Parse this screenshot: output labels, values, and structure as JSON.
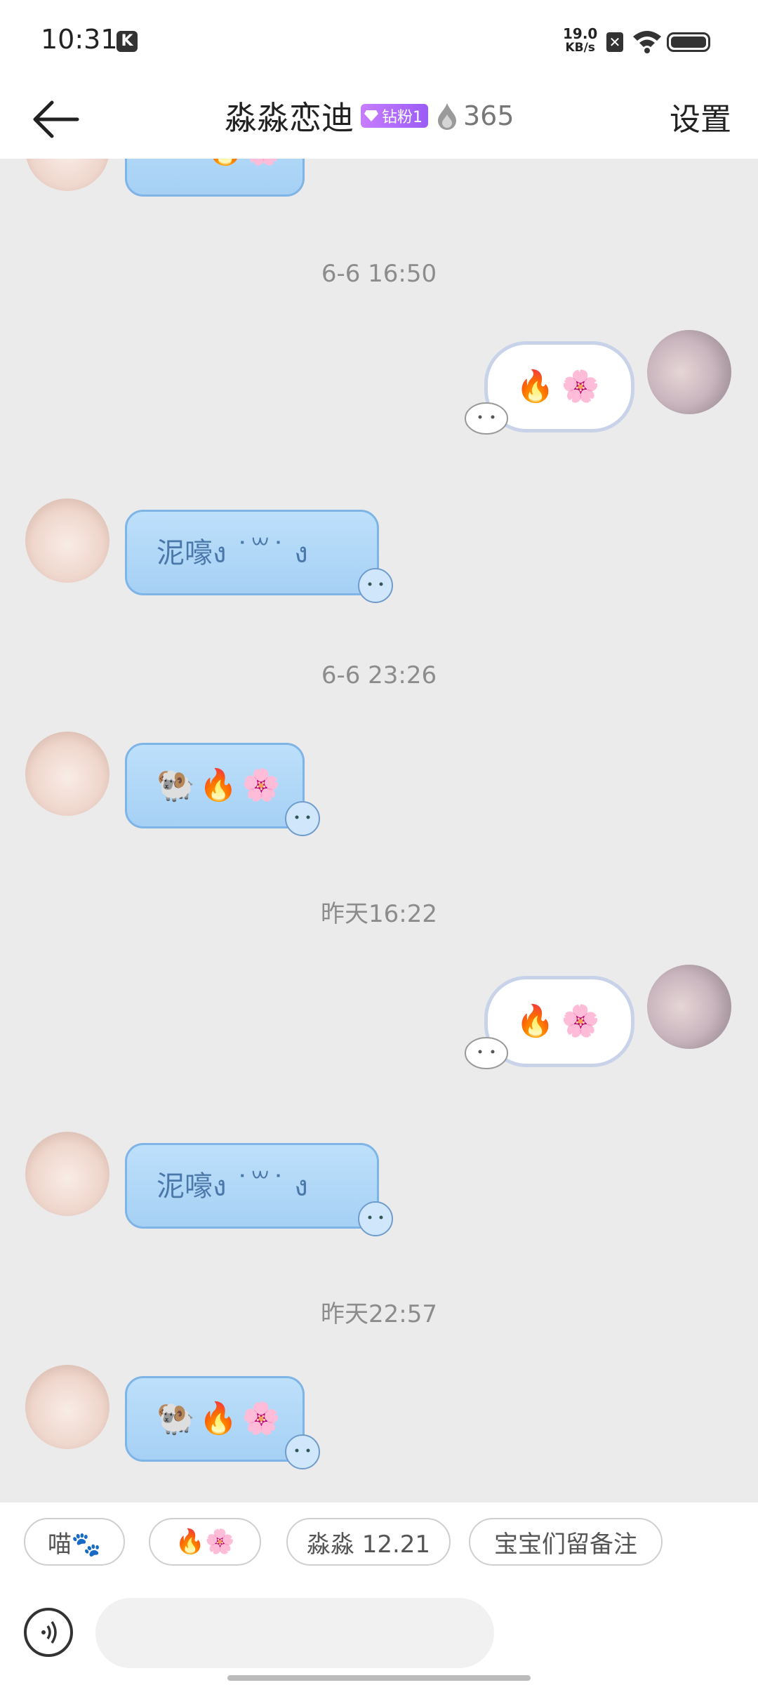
{
  "status": {
    "time": "10:31",
    "net_speed_value": "19.0",
    "net_speed_unit": "KB/s"
  },
  "header": {
    "title": "淼淼恋迪",
    "badge": "钻粉1",
    "heat": "365",
    "settings": "设置"
  },
  "messages": [
    {
      "kind": "time",
      "text": "6-6 16:50"
    },
    {
      "kind": "out",
      "emojis": [
        "🔥",
        "🌸"
      ]
    },
    {
      "kind": "in",
      "text": "泥嚎ง ˙꒳˙ ง"
    },
    {
      "kind": "time",
      "text": "6-6 23:26"
    },
    {
      "kind": "in",
      "emojis": [
        "🐏",
        "🔥",
        "🌸"
      ]
    },
    {
      "kind": "time",
      "text": "昨天16:22"
    },
    {
      "kind": "out",
      "emojis": [
        "🔥",
        "🌸"
      ]
    },
    {
      "kind": "in",
      "text": "泥嚎ง ˙꒳˙ ง"
    },
    {
      "kind": "time",
      "text": "昨天22:57"
    },
    {
      "kind": "in",
      "emojis": [
        "🐏",
        "🔥",
        "🌸"
      ]
    }
  ],
  "quick_replies": [
    "喵🐾",
    "🔥🌸",
    "淼淼 12.21",
    "宝宝们留备注"
  ],
  "input": {
    "placeholder": ""
  }
}
